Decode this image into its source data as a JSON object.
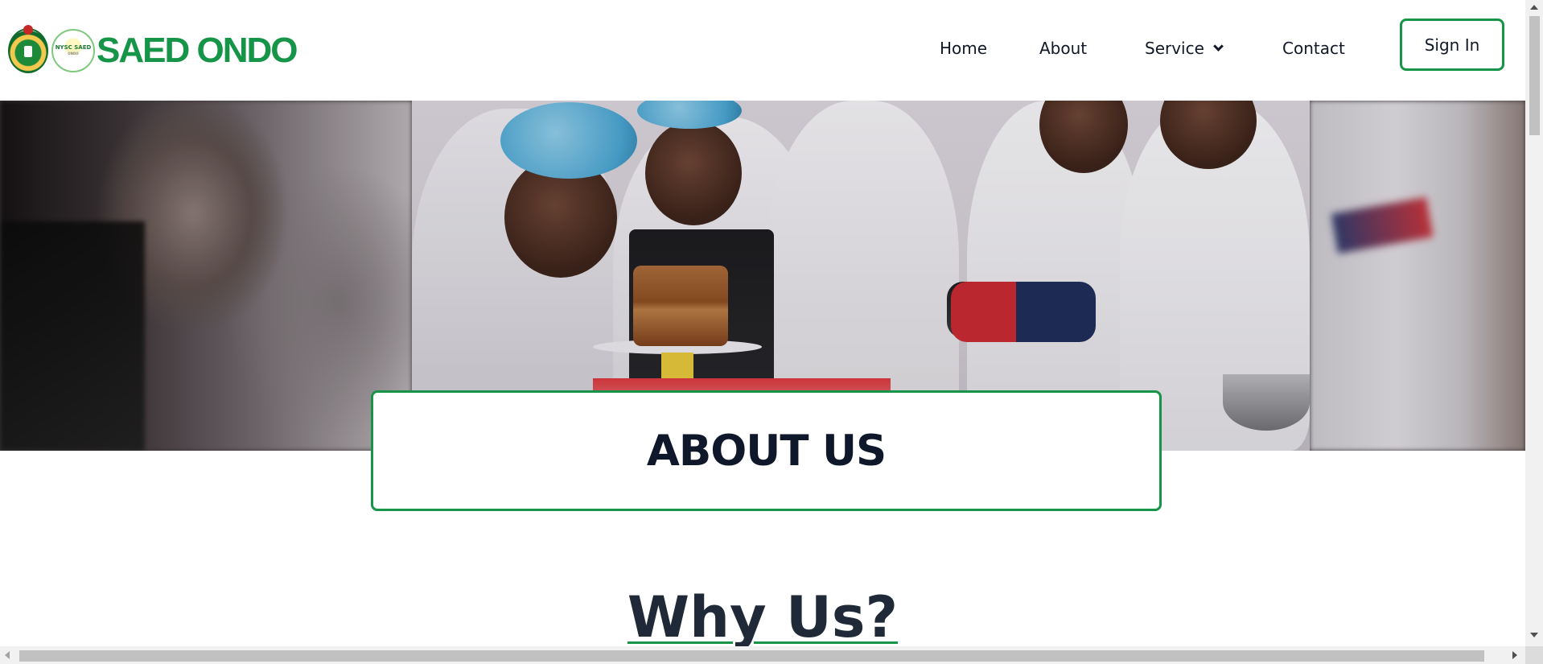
{
  "brand": {
    "logo_text": "SAED ONDO",
    "badge_text": "NYSC SAED",
    "badge_subtext": "ONDO",
    "color": "#169447"
  },
  "nav": {
    "items": [
      {
        "label": "Home"
      },
      {
        "label": "About"
      },
      {
        "label": "Service",
        "icon": "chevron-down-icon"
      },
      {
        "label": "Contact"
      }
    ],
    "signin_label": "Sign In"
  },
  "hero": {
    "image_alt": "Photo of NYSC corps members gathered around a baking demonstration with a cake"
  },
  "about": {
    "title": "ABOUT US"
  },
  "why": {
    "title": "Why Us?"
  },
  "colors": {
    "accent": "#169447",
    "text": "#111827"
  }
}
